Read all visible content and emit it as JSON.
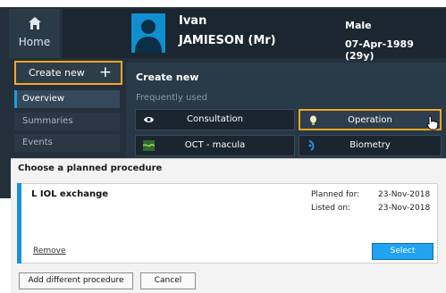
{
  "header": {
    "home_label": "Home",
    "patient": {
      "first_name": "Ivan",
      "last_name": "JAMIESON (Mr)",
      "gender": "Male",
      "dob": "07-Apr-1989 (29y)"
    }
  },
  "sidebar": {
    "create_new_label": "Create new",
    "create_new_plus": "+",
    "items": [
      {
        "label": "Overview",
        "active": true
      },
      {
        "label": "Summaries",
        "active": false
      },
      {
        "label": "Events",
        "active": false
      }
    ]
  },
  "main": {
    "title": "Create new",
    "frequently_used_label": "Frequently used",
    "tiles": [
      {
        "label": "Consultation",
        "icon": "eye-icon"
      },
      {
        "label": "Operation",
        "icon": "lightbulb-icon",
        "selected": true
      },
      {
        "label": "OCT - macula",
        "icon": "oct-scan-icon"
      },
      {
        "label": "Biometry",
        "icon": "biometry-icon"
      }
    ]
  },
  "dialog": {
    "title": "Choose a planned procedure",
    "procedure": {
      "name": "L IOL exchange",
      "planned_for_label": "Planned for:",
      "planned_for_value": "23-Nov-2018",
      "listed_on_label": "Listed on:",
      "listed_on_value": "23-Nov-2018",
      "remove_label": "Remove",
      "select_label": "Select"
    },
    "add_different_label": "Add different procedure",
    "cancel_label": "Cancel"
  },
  "colors": {
    "accent_orange": "#f5a623",
    "select_blue": "#20a3f0",
    "card_accent": "#1e90d6",
    "app_dark": "#23303c"
  }
}
